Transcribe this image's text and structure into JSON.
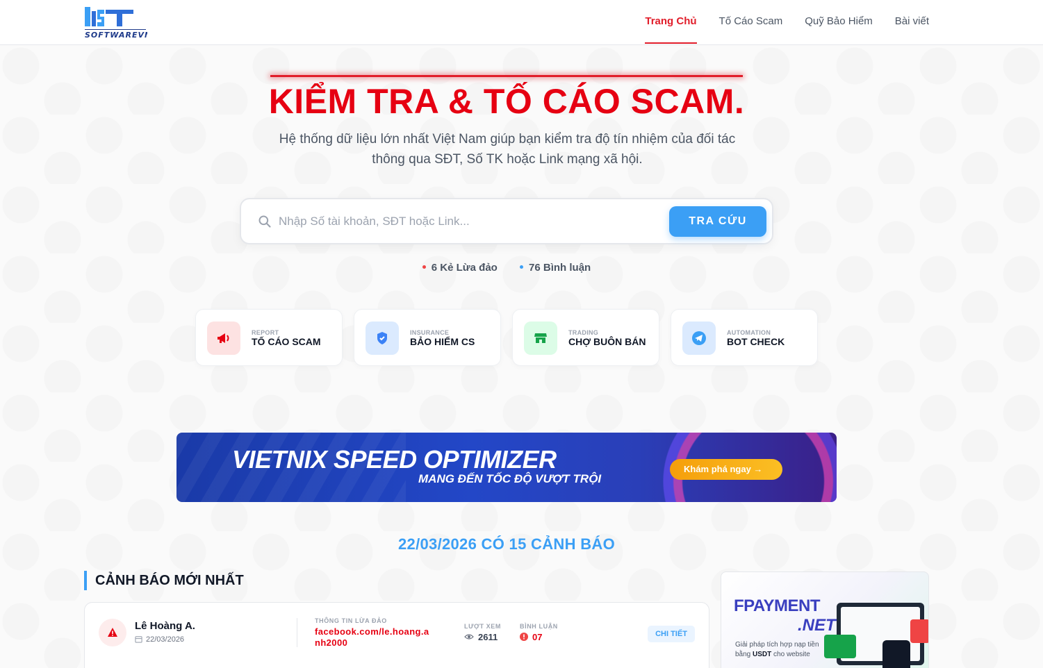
{
  "header": {
    "logo_text": "SOFTWAREVN",
    "nav": [
      {
        "label": "Trang Chủ",
        "active": true
      },
      {
        "label": "Tố Cáo Scam",
        "active": false
      },
      {
        "label": "Quỹ Bảo Hiểm",
        "active": false
      },
      {
        "label": "Bài viết",
        "active": false
      }
    ]
  },
  "hero": {
    "title": "KIỂM TRA & TỐ CÁO SCAM.",
    "subtitle": "Hệ thống dữ liệu lớn nhất Việt Nam giúp bạn kiểm tra độ tín nhiệm của đối tác thông qua SĐT, Số TK hoặc Link mạng xã hội."
  },
  "search": {
    "placeholder": "Nhập Số tài khoản, SĐT hoặc Link...",
    "value": "",
    "button_label": "TRA CỨU"
  },
  "stats": {
    "scammers": "6 Kẻ Lừa đảo",
    "comments": "76 Bình luận",
    "scammers_dot_color": "#ef4444",
    "comments_dot_color": "#3b9ff5"
  },
  "features": [
    {
      "eyebrow": "REPORT",
      "title": "TỐ CÁO SCAM",
      "icon": "megaphone-icon",
      "bg": "#fde2e2",
      "color": "#e60012"
    },
    {
      "eyebrow": "INSURANCE",
      "title": "BẢO HIỂM CS",
      "icon": "shield-icon",
      "bg": "#dbeafe",
      "color": "#3b82f6"
    },
    {
      "eyebrow": "TRADING",
      "title": "CHỢ BUÔN BÁN",
      "icon": "store-icon",
      "bg": "#dcfce7",
      "color": "#16a34a"
    },
    {
      "eyebrow": "AUTOMATION",
      "title": "BOT CHECK",
      "icon": "telegram-icon",
      "bg": "#dbeafe",
      "color": "#3b9ff5"
    }
  ],
  "banner": {
    "headline": "VIETNIX SPEED OPTIMIZER",
    "tagline": "MANG ĐẾN TỐC ĐỘ VƯỢT TRỘI",
    "cta": "Khám phá ngay →"
  },
  "daily": {
    "text": "22/03/2026 CÓ 15 CẢNH BÁO"
  },
  "latest": {
    "section_title": "CẢNH BÁO MỚI NHẤT",
    "items": [
      {
        "name": "Lê Hoàng A.",
        "date": "22/03/2026",
        "info_label": "THÔNG TIN LỪA ĐẢO",
        "info": "facebook.com/le.hoang.anh2000",
        "views_label": "LƯỢT XEM",
        "views": "2611",
        "comments_label": "BÌNH LUẬN",
        "comments": "07",
        "detail_label": "CHI TIẾT"
      }
    ]
  },
  "side_ad": {
    "brand_line1": "FPAYMENT",
    "brand_line2": ".NET",
    "desc_prefix": "Giải pháp tích hợp nạp tiền bằng ",
    "desc_bold": "USDT",
    "desc_suffix": " cho website"
  }
}
